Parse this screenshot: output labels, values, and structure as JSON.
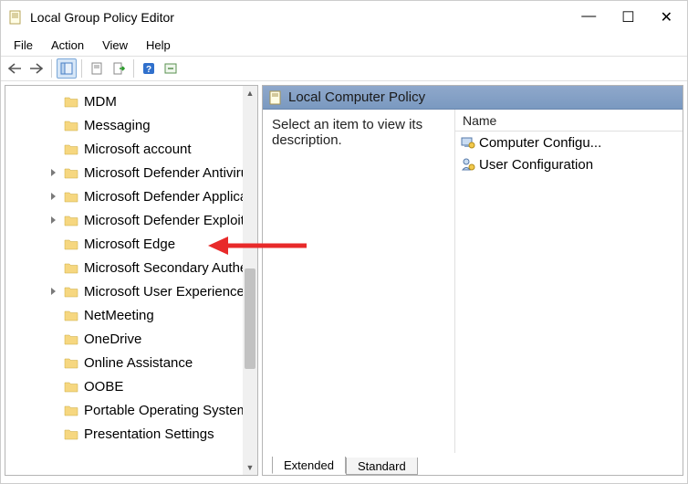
{
  "window": {
    "title": "Local Group Policy Editor",
    "controls": {
      "minimize": "—",
      "maximize": "☐",
      "close": "✕"
    }
  },
  "menu": {
    "items": [
      "File",
      "Action",
      "View",
      "Help"
    ]
  },
  "tree": {
    "items": [
      {
        "label": "MDM",
        "expandable": false
      },
      {
        "label": "Messaging",
        "expandable": false
      },
      {
        "label": "Microsoft account",
        "expandable": false
      },
      {
        "label": "Microsoft Defender Antivirus",
        "expandable": true
      },
      {
        "label": "Microsoft Defender Application Guard",
        "expandable": true
      },
      {
        "label": "Microsoft Defender Exploit Guard",
        "expandable": true
      },
      {
        "label": "Microsoft Edge",
        "expandable": false
      },
      {
        "label": "Microsoft Secondary Authentication Factor",
        "expandable": false
      },
      {
        "label": "Microsoft User Experience Virtualization",
        "expandable": true
      },
      {
        "label": "NetMeeting",
        "expandable": false
      },
      {
        "label": "OneDrive",
        "expandable": false
      },
      {
        "label": "Online Assistance",
        "expandable": false
      },
      {
        "label": "OOBE",
        "expandable": false
      },
      {
        "label": "Portable Operating System",
        "expandable": false
      },
      {
        "label": "Presentation Settings",
        "expandable": false
      }
    ]
  },
  "detail": {
    "header": "Local Computer Policy",
    "description": "Select an item to view its description.",
    "column_header": "Name",
    "rows": [
      {
        "label": "Computer Configu...",
        "icon": "computer-config-icon"
      },
      {
        "label": "User Configuration",
        "icon": "user-config-icon"
      }
    ],
    "tabs": {
      "extended": "Extended",
      "standard": "Standard"
    }
  }
}
